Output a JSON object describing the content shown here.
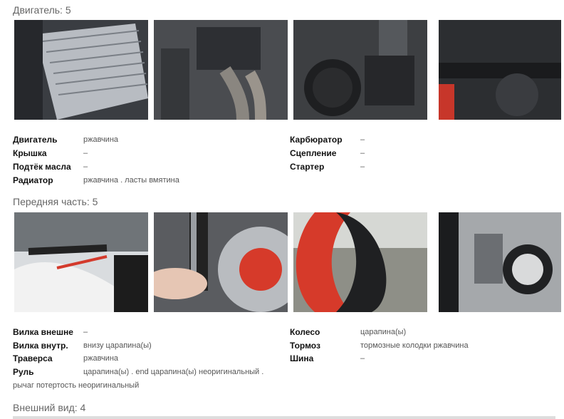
{
  "sections": [
    {
      "title": "Двигатель: 5",
      "photos": [
        {
          "icon": "radiator-photo"
        },
        {
          "icon": "engine-exhaust-photo"
        },
        {
          "icon": "engine-cover-photo"
        },
        {
          "icon": "engine-frame-photo"
        }
      ],
      "left_rows": [
        {
          "label": "Двигатель",
          "value": "ржавчина"
        },
        {
          "label": "Крышка",
          "value": "–"
        },
        {
          "label": "Подтёк масла",
          "value": "–"
        },
        {
          "label": "Радиатор",
          "value": "ржавчина . ласты вмятина"
        }
      ],
      "right_rows": [
        {
          "label": "Карбюратор",
          "value": "–"
        },
        {
          "label": "Сцепление",
          "value": "–"
        },
        {
          "label": "Стартер",
          "value": "–"
        }
      ]
    },
    {
      "title": "Передняя часть: 5",
      "photos": [
        {
          "icon": "handlebar-photo"
        },
        {
          "icon": "fork-photo"
        },
        {
          "icon": "front-wheel-photo"
        },
        {
          "icon": "front-brake-photo"
        }
      ],
      "left_rows": [
        {
          "label": "Вилка внешне",
          "value": "–"
        },
        {
          "label": "Вилка внутр.",
          "value": "внизу царапина(ы)"
        },
        {
          "label": "Траверса",
          "value": "ржавчина"
        },
        {
          "label": "Руль",
          "value": "царапина(ы) . end царапина(ы) неоригинальный ."
        }
      ],
      "left_wrap": "рычаг потертость неоригинальный",
      "right_rows": [
        {
          "label": "Колесо",
          "value": "царапина(ы)"
        },
        {
          "label": "Тормоз",
          "value": "тормозные колодки ржавчина"
        },
        {
          "label": "Шина",
          "value": "–"
        }
      ]
    },
    {
      "title": "Внешний вид: 4"
    }
  ]
}
